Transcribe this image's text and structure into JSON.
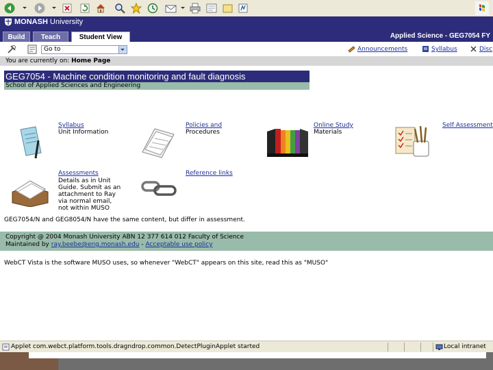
{
  "toolbar": {
    "icons": [
      "back-icon",
      "forward-icon",
      "stop-icon",
      "refresh-icon",
      "home-icon",
      "search-icon",
      "favorites-icon",
      "history-icon",
      "mail-icon",
      "print-icon",
      "edit-icon",
      "discuss-icon",
      "messenger-icon"
    ]
  },
  "header": {
    "brand": "MONASH",
    "brand_suffix": "University",
    "tabs": [
      {
        "label": "Build"
      },
      {
        "label": "Teach"
      },
      {
        "label": "Student View"
      }
    ],
    "course_title": "Applied Science - GEG7054 FY"
  },
  "navbar": {
    "goto_value": "Go to",
    "links": {
      "announcements": "Announcements",
      "syllabus": "Syllabus",
      "discussions": "Disc"
    }
  },
  "location": {
    "prefix": "You are currently on:",
    "page": "Home Page"
  },
  "banner": {
    "course_name": "GEG7054 - Machine condition monitoring and fault diagnosis",
    "school": "School of Applied Sciences and Engineering"
  },
  "tools": [
    {
      "link": "Syllabus",
      "desc": "Unit Information"
    },
    {
      "link": "Policies and",
      "desc": "Procedures"
    },
    {
      "link": "Online Study",
      "desc": "Materials"
    },
    {
      "link": "Self Assessment",
      "desc": ""
    },
    {
      "link": "Assessments",
      "desc": "Details as in Unit\nGuide. Submit as an\nattachment to Ray\nvia normal email,\nnot within MUSO"
    },
    {
      "link": "Reference links",
      "desc": ""
    }
  ],
  "note": "GEG7054/N and GEG8054/N have the same content, but differ in assessment.",
  "footer": {
    "copyright": "Copyright @ 2004 Monash University ABN 12 377 614 012   Faculty of Science",
    "maintained_prefix": "Maintained by",
    "email": "ray.beebe@eng.monash.edu",
    "separator": "-",
    "policy": "Acceptable use policy"
  },
  "vista_note": "WebCT Vista is the software MUSO uses, so whenever \"WebCT\" appears on this site, read this as \"MUSO\"",
  "statusbar": {
    "text": "Applet com.webct.platform.tools.dragndrop.common.DetectPluginApplet started",
    "zone": "Local intranet"
  },
  "colors": {
    "header_bg": "#2c2c7a",
    "accent_green": "#99bbaa",
    "link": "#1a2e9a"
  }
}
